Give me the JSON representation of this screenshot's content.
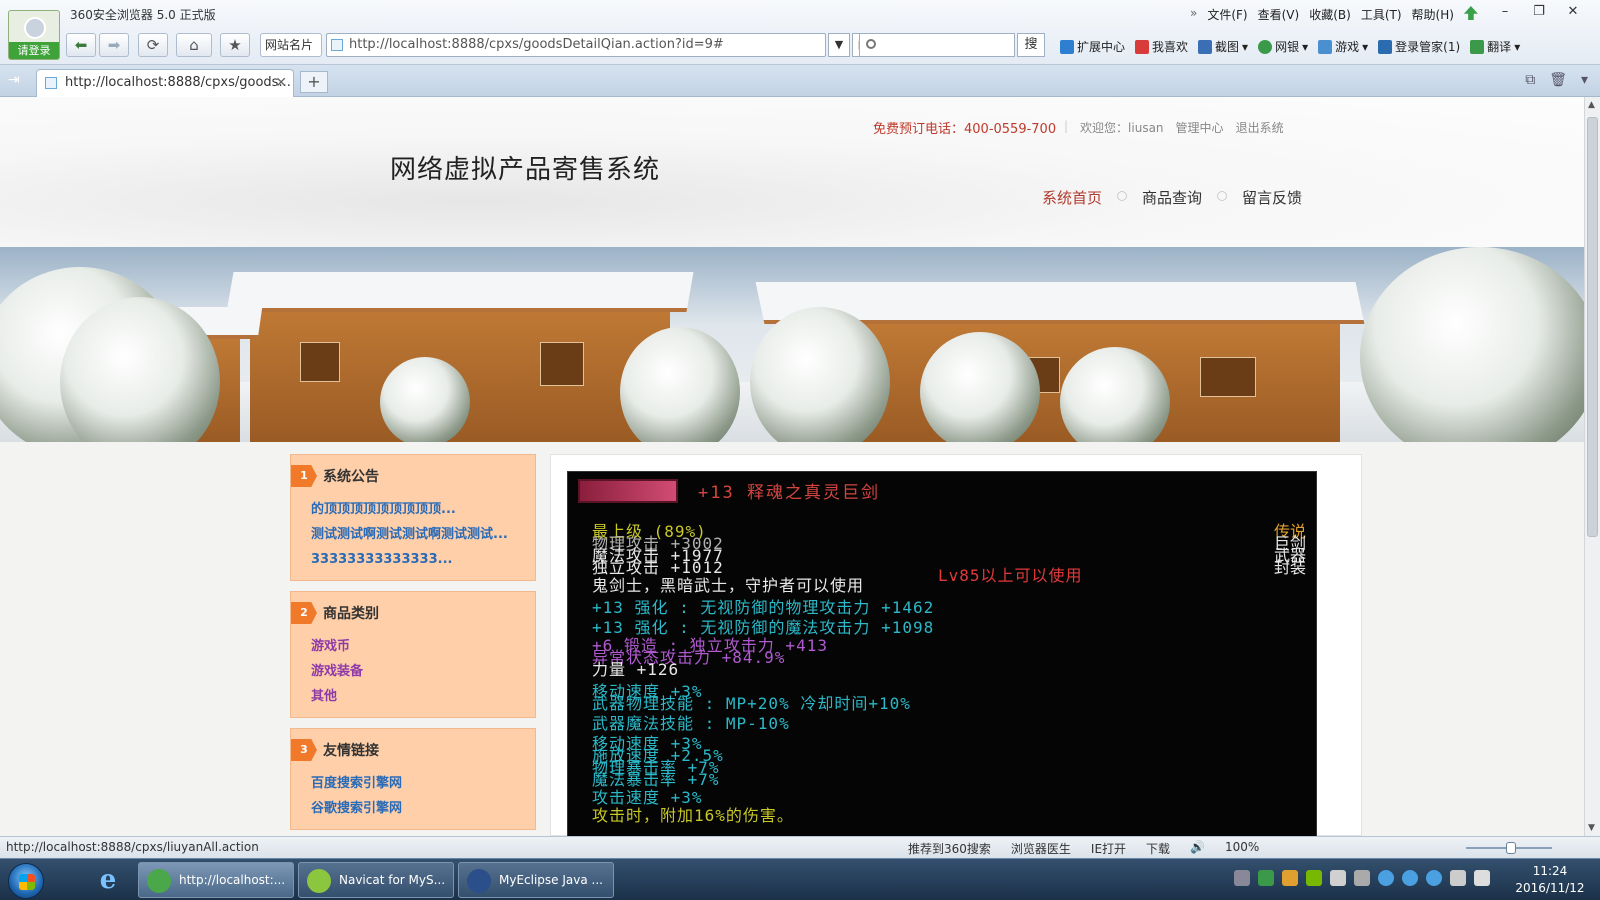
{
  "browser": {
    "title": "360安全浏览器 5.0 正式版",
    "login_label": "请登录",
    "menu": [
      "文件(F)",
      "查看(V)",
      "收藏(B)",
      "工具(T)",
      "帮助(H)"
    ],
    "menu_chevron": "»",
    "namecard_label": "网站名片",
    "url": "http://localhost:8888/cpxs/goodsDetailQian.action?id=9#",
    "search_placeholder": "",
    "search_button": "搜",
    "toolbar_items": [
      "扩展中心",
      "我喜欢",
      "截图",
      "网银",
      "游戏",
      "登录管家(1)",
      "翻译"
    ],
    "tab_title": "http://localhost:8888/cpxs/goods...",
    "status_url": "http://localhost:8888/cpxs/liuyanAll.action",
    "status_items": [
      "推荐到360搜索",
      "浏览器医生",
      "IE打开",
      "下载",
      "100%"
    ]
  },
  "site": {
    "hotline": "免费预订电话：400-0559-700",
    "welcome": "欢迎您：liusan",
    "admin_link": "管理中心",
    "logout_link": "退出系统",
    "title": "网络虚拟产品寄售系统",
    "nav": [
      "系统首页",
      "商品查询",
      "留言反馈"
    ],
    "sidebar": [
      {
        "num": "1",
        "title": "系统公告",
        "items": [
          "的顶顶顶顶顶顶顶顶顶...",
          "测试测试啊测试测试啊测试测试...",
          "33333333333333..."
        ],
        "color": "blue"
      },
      {
        "num": "2",
        "title": "商品类别",
        "items": [
          "游戏币",
          "游戏装备",
          "其他"
        ],
        "color": "purple"
      },
      {
        "num": "3",
        "title": "友情链接",
        "items": [
          "百度搜索引擎网",
          "谷歌搜索引擎网"
        ],
        "color": "blue"
      }
    ],
    "product_image": {
      "name": "+13 释魂之真灵巨剑",
      "lines": [
        {
          "text": "最上级 (89%)",
          "right": "传说",
          "cls": "y"
        },
        {
          "text": "物理攻击 +3002",
          "right": "巨剑",
          "cls": "g"
        },
        {
          "text": "魔法攻击 +1977",
          "right": "武器",
          "cls": "w"
        },
        {
          "text": "独立攻击 +1012",
          "right": "封装",
          "cls": "w"
        },
        {
          "text": "Lv85以上可以使用",
          "right": "",
          "cls": "r"
        },
        {
          "text": "鬼剑士，黑暗武士，守护者可以使用",
          "right": "",
          "cls": "w"
        },
        {
          "text": "+13 强化 : 无视防御的物理攻击力 +1462",
          "right": "",
          "cls": "c"
        },
        {
          "text": "+13 强化 : 无视防御的魔法攻击力 +1098",
          "right": "",
          "cls": "c"
        },
        {
          "text": "+6 锻造 : 独立攻击力 +413",
          "right": "",
          "cls": "p"
        },
        {
          "text": "异常状态攻击力 +84.9%",
          "right": "",
          "cls": "p"
        },
        {
          "text": "力量 +126",
          "right": "",
          "cls": "w"
        },
        {
          "text": "移动速度 +3%",
          "right": "",
          "cls": "c"
        },
        {
          "text": "武器物理技能 : MP+20% 冷却时间+10%",
          "right": "",
          "cls": "c"
        },
        {
          "text": "武器魔法技能 : MP-10%",
          "right": "",
          "cls": "c"
        },
        {
          "text": "移动速度 +3%",
          "right": "",
          "cls": "c"
        },
        {
          "text": "施放速度 +2.5%",
          "right": "",
          "cls": "c"
        },
        {
          "text": "物理暴击率 +7%",
          "right": "",
          "cls": "c"
        },
        {
          "text": "魔法暴击率 +7%",
          "right": "",
          "cls": "c"
        },
        {
          "text": "攻击速度 +3%",
          "right": "",
          "cls": "c"
        },
        {
          "text": "攻击时，附加16%的伤害。",
          "right": "",
          "cls": "y"
        }
      ]
    }
  },
  "taskbar": {
    "tasks": [
      "http://localhost:...",
      "Navicat for MyS...",
      "MyEclipse Java ..."
    ],
    "time": "11:24",
    "date": "2016/11/12"
  }
}
